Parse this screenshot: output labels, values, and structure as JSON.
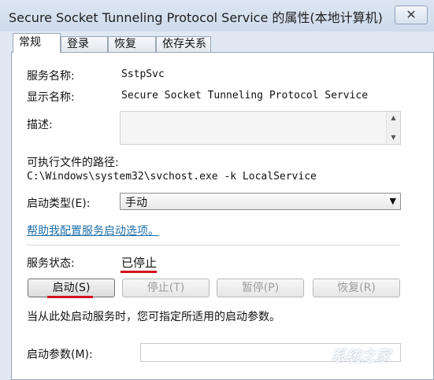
{
  "window": {
    "title": "Secure Socket Tunneling Protocol Service 的属性(本地计算机)",
    "close_glyph": "✕"
  },
  "tabs": [
    {
      "label": "常规",
      "active": true
    },
    {
      "label": "登录",
      "active": false
    },
    {
      "label": "恢复",
      "active": false
    },
    {
      "label": "依存关系",
      "active": false
    }
  ],
  "general": {
    "service_name_label": "服务名称:",
    "service_name_value": "SstpSvc",
    "display_name_label": "显示名称:",
    "display_name_value": "Secure Socket Tunneling Protocol Service",
    "description_label": "描述:",
    "description_value": "",
    "exe_path_label": "可执行文件的路径:",
    "exe_path_value": "C:\\Windows\\system32\\svchost.exe -k LocalService",
    "startup_type_label": "启动类型(E):",
    "startup_type_value": "手动",
    "help_link": "帮助我配置服务启动选项。",
    "service_status_label": "服务状态:",
    "service_status_value": "已停止",
    "buttons": {
      "start": "启动(S)",
      "stop": "停止(T)",
      "pause": "暂停(P)",
      "resume": "恢复(R)"
    },
    "hint_text": "当从此处启动服务时，您可指定所适用的启动参数。",
    "start_params_label": "启动参数(M):",
    "start_params_value": ""
  },
  "watermark": "系统之家",
  "colors": {
    "link": "#1f6fa9",
    "highlight_underline": "#d2141e",
    "frame": "#dfe8f3"
  }
}
